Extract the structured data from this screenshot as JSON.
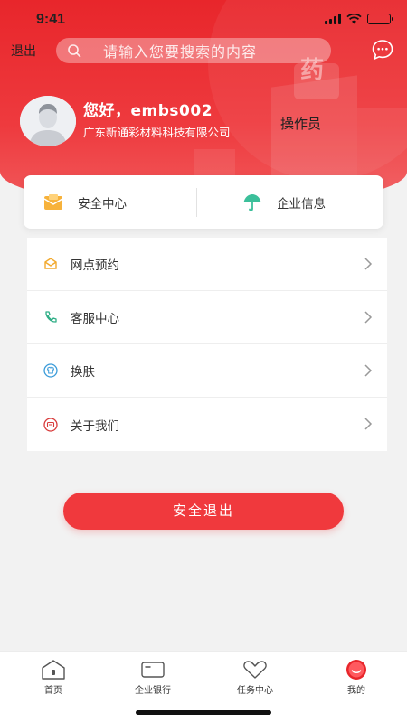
{
  "status_bar": {
    "time": "9:41"
  },
  "header": {
    "exit_label": "退出",
    "search_placeholder": "请输入您要搜索的内容",
    "decor_glyph": "药"
  },
  "profile": {
    "greeting": "您好，embs002",
    "company": "广东新通彩材料科技有限公司",
    "role": "操作员"
  },
  "quick_links": [
    {
      "label": "安全中心",
      "icon": "safe-center-icon"
    },
    {
      "label": "企业信息",
      "icon": "umbrella-icon"
    }
  ],
  "menu": [
    {
      "label": "网点预约",
      "icon": "appointment-icon"
    },
    {
      "label": "客服中心",
      "icon": "phone-icon"
    },
    {
      "label": "换肤",
      "icon": "shirt-icon"
    },
    {
      "label": "关于我们",
      "icon": "about-icon"
    }
  ],
  "logout_label": "安全退出",
  "tabbar": [
    {
      "label": "首页",
      "icon": "home-icon"
    },
    {
      "label": "企业银行",
      "icon": "card-icon"
    },
    {
      "label": "任务中心",
      "icon": "heart-icon"
    },
    {
      "label": "我的",
      "icon": "profile-face-icon",
      "active": true
    }
  ],
  "colors": {
    "brand_red": "#e8262b",
    "button_red": "#f0393d",
    "background": "#f2f2f2"
  }
}
